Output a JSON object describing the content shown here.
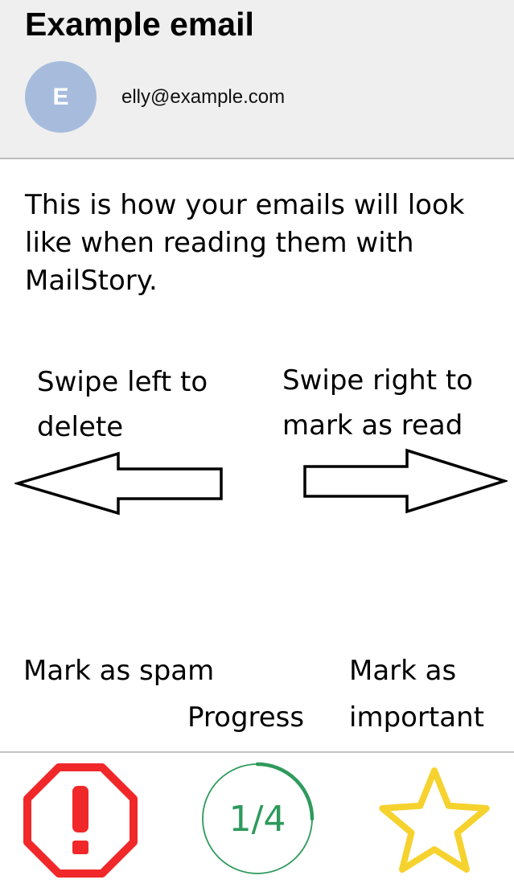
{
  "email": {
    "subject": "Example email",
    "sender_initial": "E",
    "sender_address": "elly@example.com",
    "body": "This is how your emails will look like when reading them with MailStory."
  },
  "hints": {
    "left": "Swipe left to delete",
    "right": "Swipe right to mark as read"
  },
  "actions": {
    "spam_label": "Mark as spam",
    "progress_label": "Progress",
    "important_label": "Mark as important"
  },
  "progress": {
    "text": "1/4",
    "fraction": 0.25
  },
  "icons": {
    "avatar": "avatar-circle",
    "left_arrow": "arrow-left-icon",
    "right_arrow": "arrow-right-icon",
    "spam": "octagon-exclamation-icon",
    "important": "star-outline-icon"
  },
  "colors": {
    "header_bg": "#efefef",
    "avatar_bg": "#a7bcdd",
    "spam_red": "#f0282a",
    "progress_green": "#2e9a5b",
    "progress_ring_light": "#9fd2b3",
    "star_yellow": "#f6d22e"
  }
}
